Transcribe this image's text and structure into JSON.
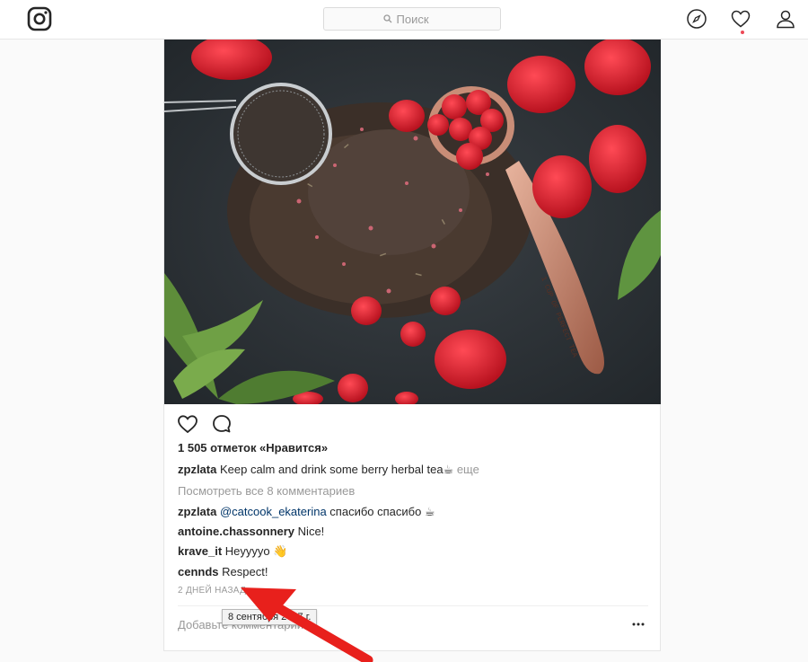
{
  "header": {
    "logo_icon": "instagram-logo-icon",
    "search_placeholder": "Поиск",
    "search_icon": "search-icon",
    "nav": [
      "explore-compass-icon",
      "activity-heart-icon",
      "profile-person-icon"
    ]
  },
  "post": {
    "image_description_icon": "photo",
    "actions": [
      "like-heart-icon",
      "comment-bubble-icon"
    ],
    "likes": "1 505 отметок «Нравится»",
    "caption": {
      "username": "zpzlata",
      "text": "Keep calm and drink some berry herbal tea☕",
      "more": "еще"
    },
    "view_all_comments": "Посмотреть все 8 комментариев",
    "comments": [
      {
        "username": "zpzlata",
        "mention": "@catcook_ekaterina",
        "text": " спасибо спасибо ☕"
      },
      {
        "username": "antoine.chassonnery",
        "mention": "",
        "text": "Nice!"
      },
      {
        "username": "krave_it",
        "mention": "",
        "text": "Heyyyyo 👋"
      },
      {
        "username": "cennds",
        "mention": "",
        "text": "Respect!"
      }
    ],
    "timestamp": "2 ДНЕЙ НАЗАД",
    "tooltip": "8 сентября 2017 г.",
    "add_comment_placeholder": "Добавьте комментарий...",
    "options_icon": "more-options-icon"
  },
  "colors": {
    "accent_link": "#003569",
    "annotation_arrow": "#e8201c",
    "notification_dot": "#ed4956"
  }
}
